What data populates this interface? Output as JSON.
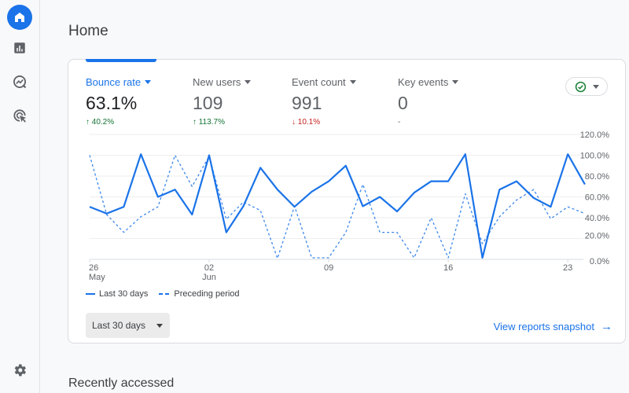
{
  "sidebar": {
    "items": [
      {
        "name": "home",
        "icon": "home-icon",
        "active": true
      },
      {
        "name": "reports",
        "icon": "bar-chart-icon",
        "active": false
      },
      {
        "name": "explore",
        "icon": "explore-icon",
        "active": false
      },
      {
        "name": "advertising",
        "icon": "target-cursor-icon",
        "active": false
      }
    ],
    "settings_icon": "gear-icon"
  },
  "page": {
    "title": "Home",
    "recent_title": "Recently accessed"
  },
  "metrics": [
    {
      "label": "Bounce rate",
      "value": "63.1%",
      "change": "40.2%",
      "direction": "up",
      "active": true
    },
    {
      "label": "New users",
      "value": "109",
      "change": "113.7%",
      "direction": "up",
      "active": false
    },
    {
      "label": "Event count",
      "value": "991",
      "change": "10.1%",
      "direction": "down",
      "active": false
    },
    {
      "label": "Key events",
      "value": "0",
      "change": "-",
      "direction": "none",
      "active": false
    }
  ],
  "arrows": {
    "up": "↑",
    "down": "↓"
  },
  "status_pill": {
    "icon": "check-circle-icon"
  },
  "legend": {
    "current": "Last 30 days",
    "previous": "Preceding period"
  },
  "date_range": {
    "label": "Last 30 days"
  },
  "snapshot_link": {
    "label": "View reports snapshot",
    "arrow": "→"
  },
  "colors": {
    "accent": "#1a73e8",
    "up": "#137333",
    "down": "#c5221f"
  },
  "chart_data": {
    "type": "line",
    "title": "",
    "xlabel": "",
    "ylabel": "Bounce rate",
    "ylim": [
      0,
      120
    ],
    "y_ticks": [
      "120.0%",
      "100.0%",
      "80.0%",
      "60.0%",
      "40.0%",
      "20.0%",
      "0.0%"
    ],
    "y_tick_values": [
      120,
      100,
      80,
      60,
      40,
      20,
      0
    ],
    "x_ticks": [
      {
        "index": 0,
        "line1": "26",
        "line2": "May"
      },
      {
        "index": 7,
        "line1": "02",
        "line2": "Jun"
      },
      {
        "index": 14,
        "line1": "09",
        "line2": ""
      },
      {
        "index": 21,
        "line1": "16",
        "line2": ""
      },
      {
        "index": 28,
        "line1": "23",
        "line2": ""
      }
    ],
    "x_count": 30,
    "grid": true,
    "legend_position": "bottom-left",
    "series": [
      {
        "name": "Last 30 days",
        "style": "solid",
        "values": [
          50.5,
          44,
          50.5,
          101,
          60,
          67,
          43,
          100,
          26,
          51,
          88,
          67,
          50.5,
          65,
          75,
          90,
          51,
          60,
          46,
          64,
          75,
          75,
          101,
          1.5,
          67,
          75,
          59,
          50.5,
          101,
          72
        ]
      },
      {
        "name": "Preceding period",
        "style": "dashed",
        "values": [
          100,
          43,
          26,
          41,
          50.5,
          100,
          70,
          99,
          38.5,
          55,
          47,
          1,
          51,
          1.5,
          1.5,
          26,
          72,
          26,
          26,
          1.5,
          40,
          1.5,
          63,
          15,
          41,
          57,
          67,
          39,
          50.5,
          44
        ]
      }
    ]
  }
}
